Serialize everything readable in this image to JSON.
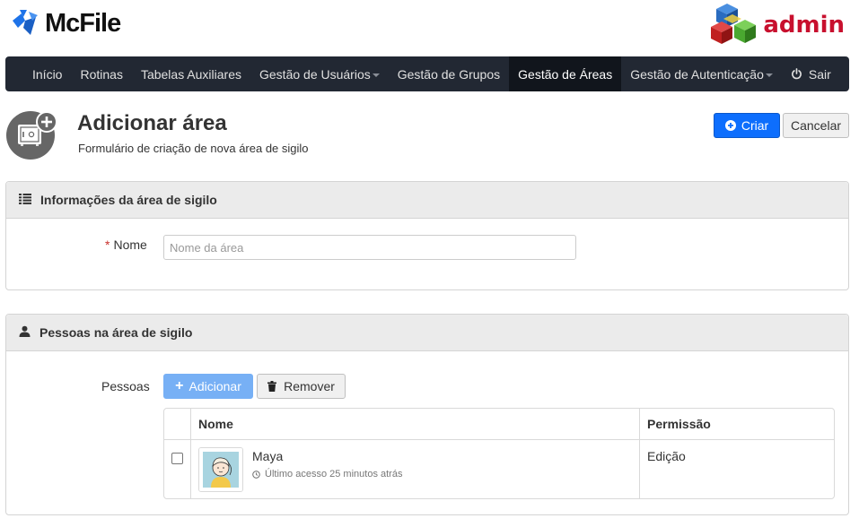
{
  "header": {
    "brand": "McFile",
    "admin_label": "admin"
  },
  "nav": {
    "items": [
      {
        "label": "Início"
      },
      {
        "label": "Rotinas"
      },
      {
        "label": "Tabelas Auxiliares"
      },
      {
        "label": "Gestão de Usuários"
      },
      {
        "label": "Gestão de Grupos"
      },
      {
        "label": "Gestão de Áreas"
      },
      {
        "label": "Gestão de Autenticação"
      }
    ],
    "active": "Gestão de Áreas",
    "logout": "Sair"
  },
  "page": {
    "title": "Adicionar área",
    "subtitle": "Formulário de criação de nova área de sigilo",
    "create_label": "Criar",
    "cancel_label": "Cancelar"
  },
  "info_panel": {
    "title": "Informações da área de sigilo",
    "required_mark": "*",
    "name_label": "Nome",
    "name_value": "",
    "name_placeholder": "Nome da área"
  },
  "people_panel": {
    "title": "Pessoas na área de sigilo",
    "people_label": "Pessoas",
    "add_label": "Adicionar",
    "remove_label": "Remover",
    "columns": {
      "name": "Nome",
      "permission": "Permissão"
    },
    "rows": [
      {
        "name": "Maya",
        "last_access": "Último acesso 25 minutos atrás",
        "permission": "Edição",
        "checked": false
      }
    ]
  },
  "colors": {
    "navbar": "#222833",
    "primary": "#0d6efd",
    "add_button": "#77b0f5",
    "admin_red": "#c8102e"
  }
}
